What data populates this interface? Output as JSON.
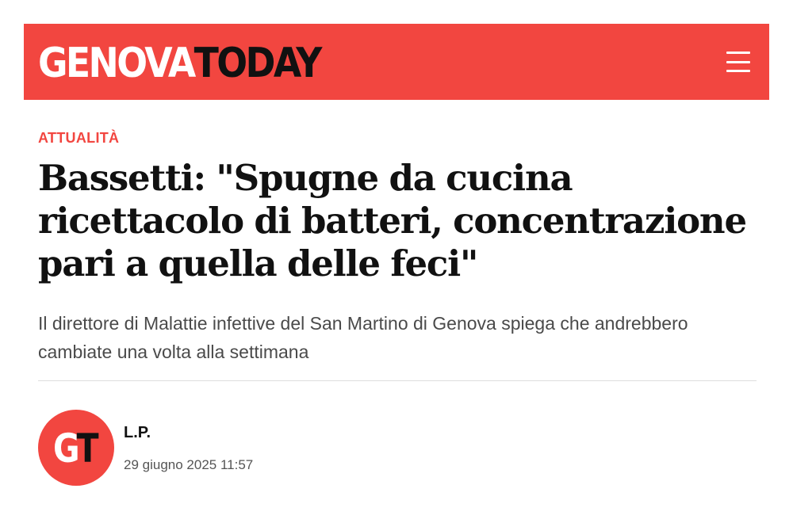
{
  "header": {
    "logo_part_1": "GENOVA",
    "logo_part_2": "TODAY",
    "menu_icon": "hamburger-menu-icon",
    "brand_color": "#f24640"
  },
  "article": {
    "category": "ATTUALITÀ",
    "title": "Bassetti: \"Spugne da cucina ricettacolo di batteri, concentrazione pari a quella delle feci\"",
    "subtitle": "Il direttore di Malattie infettive del San Martino di Genova spiega che andrebbero cambiate una volta alla settimana"
  },
  "byline": {
    "avatar_part_1": "G",
    "avatar_part_2": "T",
    "author": "L.P.",
    "date": "29 giugno 2025 11:57"
  }
}
